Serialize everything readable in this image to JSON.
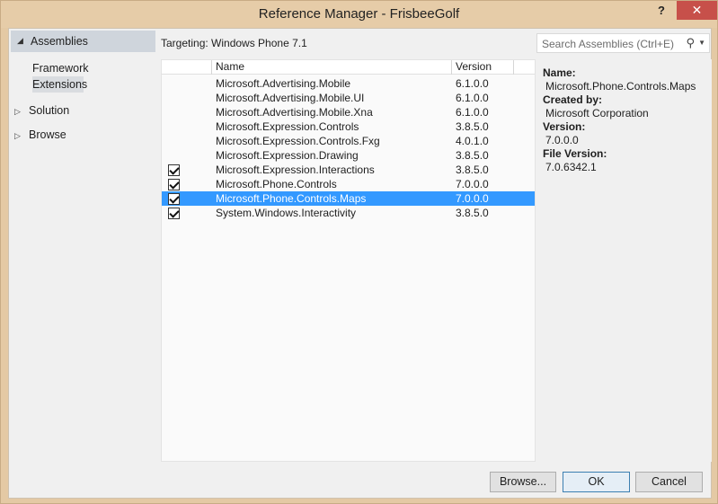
{
  "window": {
    "title": "Reference Manager - FrisbeeGolf",
    "help_label": "?",
    "close_label": "✕"
  },
  "nav": {
    "assemblies_label": "Assemblies",
    "framework_label": "Framework",
    "extensions_label": "Extensions",
    "solution_label": "Solution",
    "browse_label": "Browse"
  },
  "targeting": "Targeting: Windows Phone 7.1",
  "search": {
    "placeholder": "Search Assemblies (Ctrl+E)"
  },
  "grid": {
    "headers": {
      "name": "Name",
      "version": "Version"
    },
    "rows": [
      {
        "name": "Microsoft.Advertising.Mobile",
        "version": "6.1.0.0",
        "checked": false,
        "selected": false
      },
      {
        "name": "Microsoft.Advertising.Mobile.UI",
        "version": "6.1.0.0",
        "checked": false,
        "selected": false
      },
      {
        "name": "Microsoft.Advertising.Mobile.Xna",
        "version": "6.1.0.0",
        "checked": false,
        "selected": false
      },
      {
        "name": "Microsoft.Expression.Controls",
        "version": "3.8.5.0",
        "checked": false,
        "selected": false
      },
      {
        "name": "Microsoft.Expression.Controls.Fxg",
        "version": "4.0.1.0",
        "checked": false,
        "selected": false
      },
      {
        "name": "Microsoft.Expression.Drawing",
        "version": "3.8.5.0",
        "checked": false,
        "selected": false
      },
      {
        "name": "Microsoft.Expression.Interactions",
        "version": "3.8.5.0",
        "checked": true,
        "selected": false
      },
      {
        "name": "Microsoft.Phone.Controls",
        "version": "7.0.0.0",
        "checked": true,
        "selected": false
      },
      {
        "name": "Microsoft.Phone.Controls.Maps",
        "version": "7.0.0.0",
        "checked": true,
        "selected": true
      },
      {
        "name": "System.Windows.Interactivity",
        "version": "3.8.5.0",
        "checked": true,
        "selected": false
      }
    ]
  },
  "details": {
    "name_label": "Name:",
    "name_value": "Microsoft.Phone.Controls.Maps",
    "created_label": "Created by:",
    "created_value": "Microsoft Corporation",
    "version_label": "Version:",
    "version_value": "7.0.0.0",
    "file_version_label": "File Version:",
    "file_version_value": "7.0.6342.1"
  },
  "buttons": {
    "browse": "Browse...",
    "ok": "OK",
    "cancel": "Cancel"
  },
  "colors": {
    "selection": "#3399ff",
    "close_button": "#c7504a",
    "title_bar": "#e6cca8"
  }
}
